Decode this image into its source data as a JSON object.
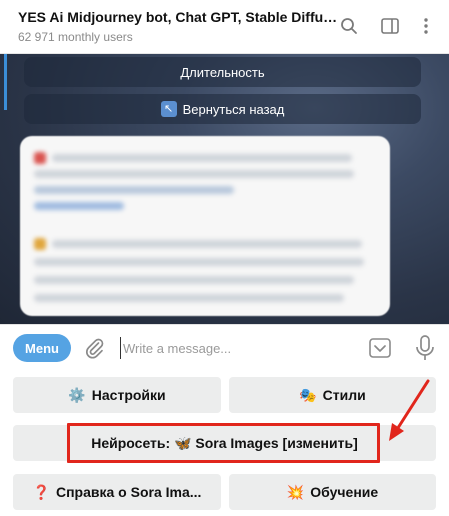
{
  "header": {
    "title": "YES Ai Midjourney bot, Chat GPT, Stable Diffusio...",
    "subtitle": "62 971 monthly users"
  },
  "chat": {
    "inline_buttons": [
      {
        "label": "Длительность"
      },
      {
        "icon": "↖",
        "label": "Вернуться назад"
      }
    ]
  },
  "input": {
    "menu_label": "Menu",
    "placeholder": "Write a message..."
  },
  "keyboard": {
    "rows": [
      [
        {
          "icon": "⚙️",
          "label": "Настройки"
        },
        {
          "icon": "🎭",
          "label": "Стили"
        }
      ],
      [
        {
          "label": "Нейросеть: 🦋 Sora Images [изменить]"
        }
      ],
      [
        {
          "icon": "❓",
          "label": "Справка о Sora Ima..."
        },
        {
          "icon": "💥",
          "label": "Обучение"
        }
      ]
    ]
  },
  "colors": {
    "accent": "#55a3e3",
    "highlight": "#e1261c"
  }
}
